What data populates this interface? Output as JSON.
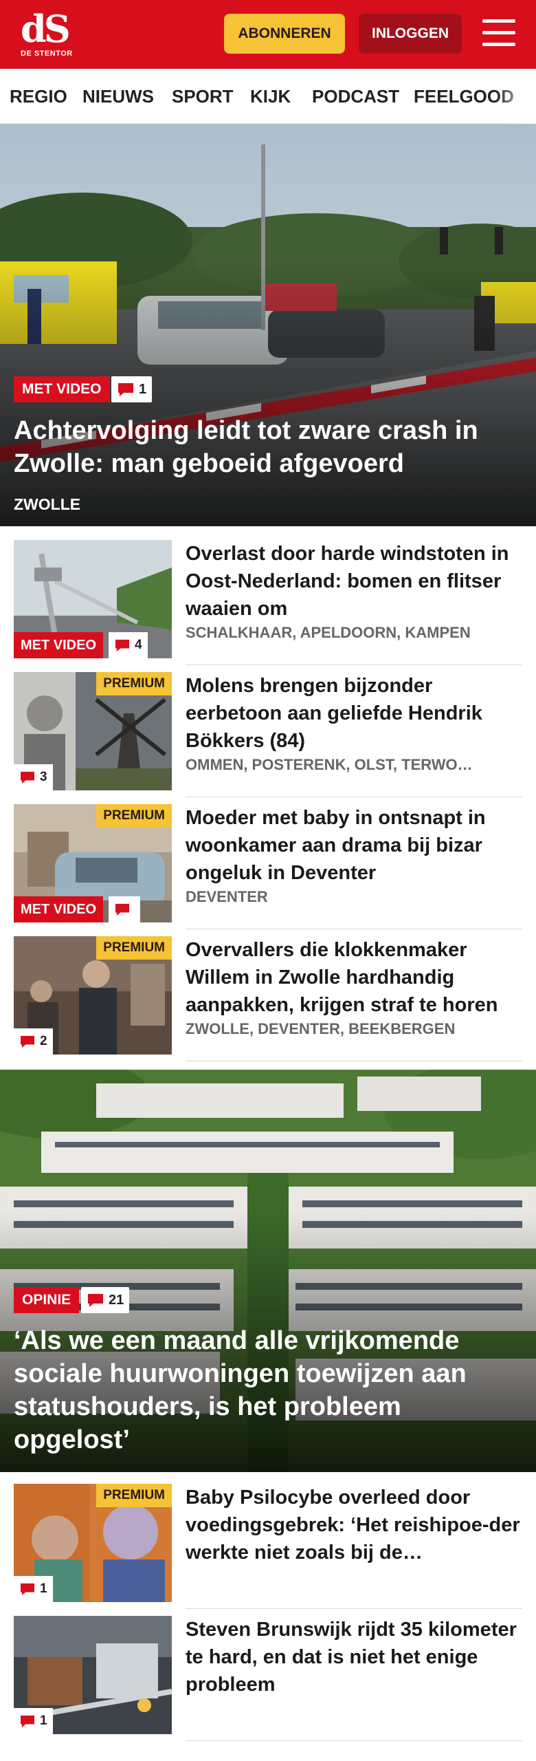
{
  "header": {
    "logo_mark": "dS",
    "logo_sub": "DE STENTOR",
    "subscribe_label": "ABONNEREN",
    "login_label": "INLOGGEN"
  },
  "nav": {
    "items": [
      "REGIO",
      "NIEUWS",
      "SPORT",
      "KIJK",
      "PODCAST",
      "FEELGOOD"
    ]
  },
  "hero": {
    "label": "MET VIDEO",
    "comments": "1",
    "title": "Achtervolging leidt tot zware crash in Zwolle: man geboeid afgevoerd",
    "location": "ZWOLLE"
  },
  "articles": [
    {
      "title": "Overlast door harde windstoten in Oost-Nederland: bomen en flitser waaien om",
      "location": "SCHALKHAAR, APELDOORN, KAMPEN",
      "video_label": "MET VIDEO",
      "comments": "4"
    },
    {
      "title": "Molens brengen bijzonder eerbetoon aan geliefde Hendrik Bökkers (84)",
      "location": "OMMEN, POSTERENK, OLST, TERWO…",
      "premium_label": "PREMIUM",
      "comments": "3"
    },
    {
      "title": "Moeder met baby in ontsnapt in woonkamer aan drama bij bizar ongeluk in Deventer",
      "location": "DEVENTER",
      "premium_label": "PREMIUM",
      "video_label": "MET VIDEO",
      "comments": ""
    },
    {
      "title": "Overvallers die klokkenmaker Willem in Zwolle hardhandig aanpakken, krijgen straf te horen",
      "location": "ZWOLLE, DEVENTER, BEEKBERGEN",
      "premium_label": "PREMIUM",
      "comments": "2"
    },
    {
      "title": "Baby Psilocybe overleed door voedingsgebrek: ‘Het reishipoe-der werkte niet zoals bij de…",
      "location": "",
      "premium_label": "PREMIUM",
      "comments": "1"
    },
    {
      "title": "Steven Brunswijk rijdt 35 kilometer te hard, en dat is niet het enige probleem",
      "location": "",
      "comments": "1"
    }
  ],
  "opinion": {
    "label": "OPINIE",
    "comments": "21",
    "title": "‘Als we een maand alle vrijkomende sociale huurwoningen toewijzen aan statushouders, is het probleem opgelost’"
  },
  "colors": {
    "brand_red": "#d70f1c",
    "login_red": "#a3101a",
    "premium_yellow": "#f5c335"
  }
}
